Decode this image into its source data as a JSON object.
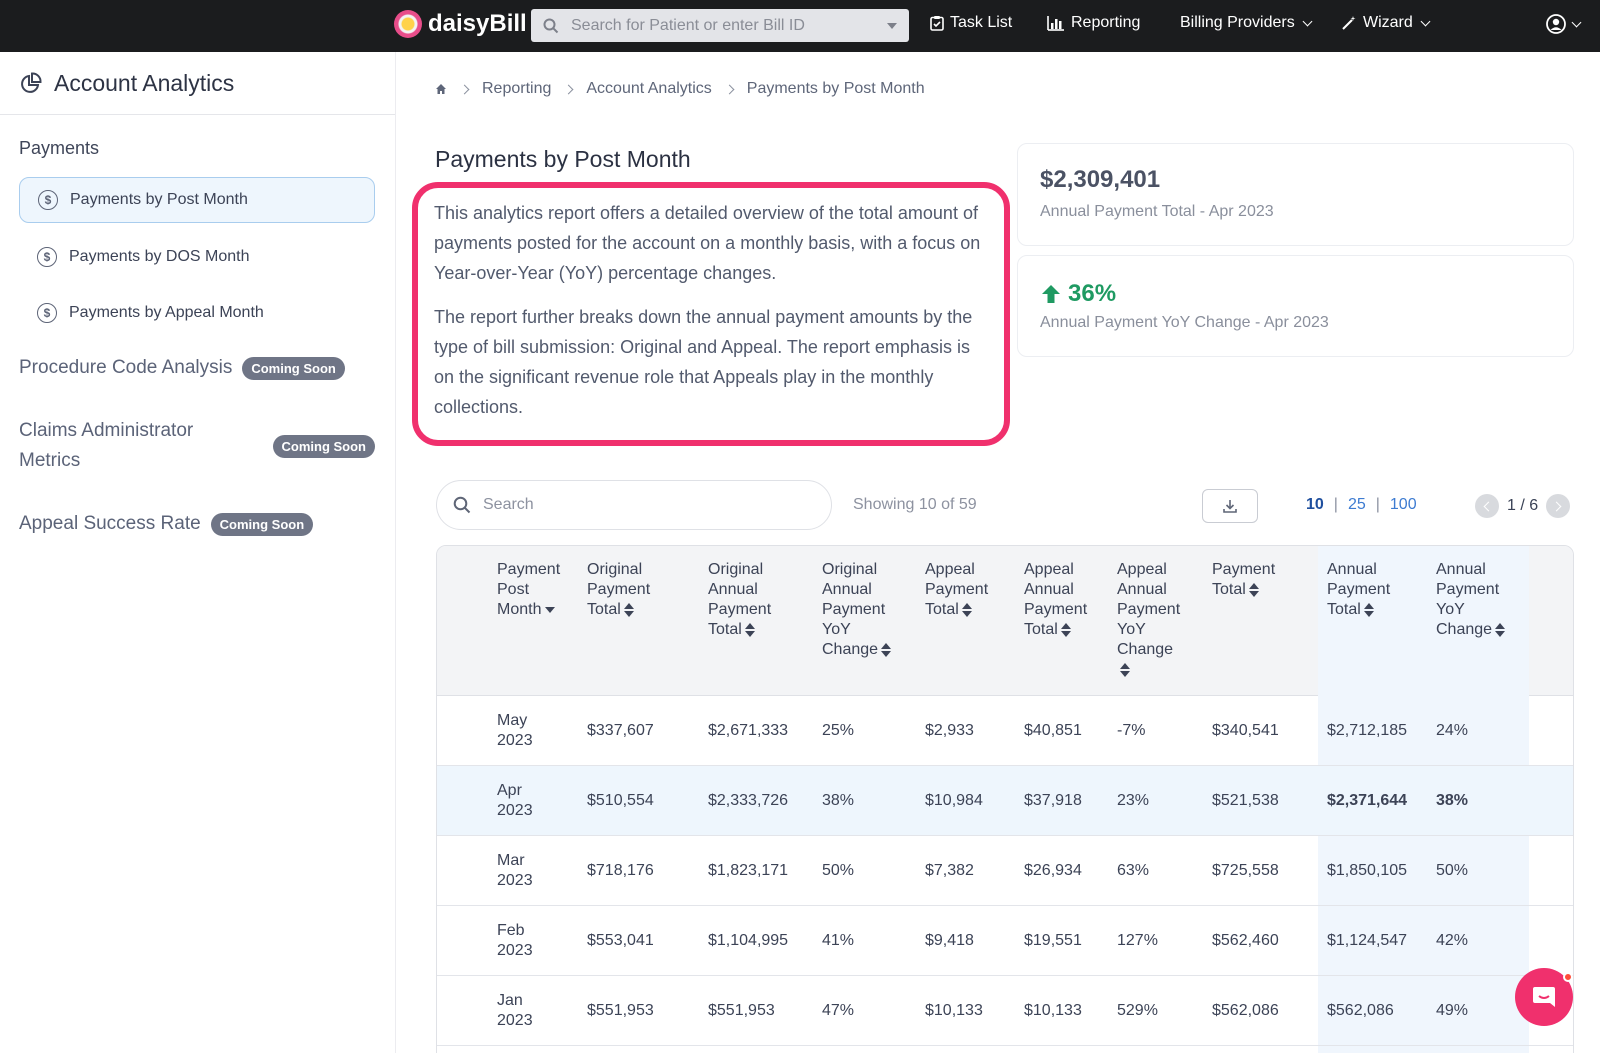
{
  "topbar": {
    "brand": "daisyBill",
    "search_placeholder": "Search for Patient or enter Bill ID",
    "nav": {
      "task_list": "Task List",
      "reporting": "Reporting",
      "billing_providers": "Billing Providers",
      "wizard": "Wizard"
    }
  },
  "sidebar": {
    "title": "Account Analytics",
    "payments_section": "Payments",
    "payment_items": [
      {
        "label": "Payments by Post Month"
      },
      {
        "label": "Payments by DOS Month"
      },
      {
        "label": "Payments by Appeal Month"
      }
    ],
    "other_sections": [
      {
        "label": "Procedure Code Analysis",
        "badge": "Coming Soon"
      },
      {
        "label_line1": "Claims Administrator",
        "label_line2": "Metrics",
        "badge": "Coming Soon"
      },
      {
        "label": "Appeal Success Rate",
        "badge": "Coming Soon"
      }
    ]
  },
  "breadcrumb": [
    "Reporting",
    "Account Analytics",
    "Payments by Post Month"
  ],
  "page": {
    "title": "Payments by Post Month",
    "description_p1": "This analytics report offers a detailed overview of the total amount of payments posted for the account on a monthly basis, with a focus on Year-over-Year (YoY) percentage changes.",
    "description_p2": "The report further breaks down the annual payment amounts by the type of bill submission: Original and Appeal. The report emphasis is on the significant revenue role that Appeals play in the monthly collections."
  },
  "stats": {
    "annual_total_value": "$2,309,401",
    "annual_total_label": "Annual Payment Total - Apr 2023",
    "yoy_value": "36%",
    "yoy_label": "Annual Payment YoY Change - Apr 2023",
    "yoy_color": "#1f9a62"
  },
  "table_controls": {
    "search_placeholder": "Search",
    "showing": "Showing 10 of 59",
    "page_sizes": [
      "10",
      "25",
      "100"
    ],
    "page_indicator": "1 / 6"
  },
  "table": {
    "headers": [
      [
        "Payment",
        "Post",
        "Month"
      ],
      [
        "Original",
        "Payment",
        "Total"
      ],
      [
        "Original",
        "Annual",
        "Payment",
        "Total"
      ],
      [
        "Original",
        "Annual",
        "Payment",
        "YoY",
        "Change"
      ],
      [
        "Appeal",
        "Payment",
        "Total"
      ],
      [
        "Appeal",
        "Annual",
        "Payment",
        "Total"
      ],
      [
        "Appeal",
        "Annual",
        "Payment",
        "YoY",
        "Change"
      ],
      [
        "Payment",
        "Total"
      ],
      [
        "Annual",
        "Payment",
        "Total"
      ],
      [
        "Annual",
        "Payment",
        "YoY",
        "Change"
      ]
    ],
    "rows": [
      {
        "month": "May",
        "year": "2023",
        "cells": [
          "$337,607",
          "$2,671,333",
          "25%",
          "$2,933",
          "$40,851",
          "-7%",
          "$340,541",
          "$2,712,185",
          "24%"
        ]
      },
      {
        "month": "Apr",
        "year": "2023",
        "cells": [
          "$510,554",
          "$2,333,726",
          "38%",
          "$10,984",
          "$37,918",
          "23%",
          "$521,538",
          "$2,371,644",
          "38%"
        ]
      },
      {
        "month": "Mar",
        "year": "2023",
        "cells": [
          "$718,176",
          "$1,823,171",
          "50%",
          "$7,382",
          "$26,934",
          "63%",
          "$725,558",
          "$1,850,105",
          "50%"
        ]
      },
      {
        "month": "Feb",
        "year": "2023",
        "cells": [
          "$553,041",
          "$1,104,995",
          "41%",
          "$9,418",
          "$19,551",
          "127%",
          "$562,460",
          "$1,124,547",
          "42%"
        ]
      },
      {
        "month": "Jan",
        "year": "2023",
        "cells": [
          "$551,953",
          "$551,953",
          "47%",
          "$10,133",
          "$10,133",
          "529%",
          "$562,086",
          "$562,086",
          "49%"
        ]
      }
    ]
  }
}
